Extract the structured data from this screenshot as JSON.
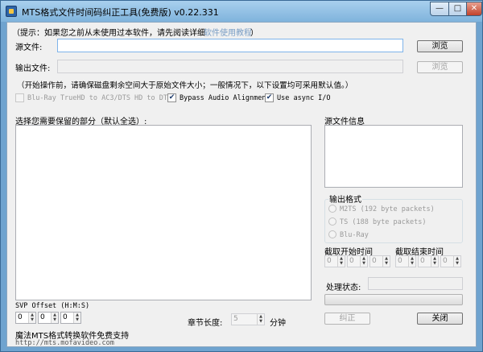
{
  "window": {
    "title": "MTS格式文件时间码纠正工具(免费版) v0.22.331",
    "minimize_label": "—",
    "maximize_label": "□",
    "close_label": "✕"
  },
  "hint": {
    "text": "（提示：如果您之前从未使用过本软件，请先阅读详细",
    "link": "软件使用教程",
    "suffix": "）"
  },
  "source": {
    "label": "源文件:",
    "value": "",
    "browse_label": "浏览"
  },
  "output": {
    "label": "输出文件:",
    "value": "",
    "browse_label": "浏览"
  },
  "notice": "（开始操作前，请确保磁盘剩余空间大于原始文件大小；一般情况下，以下设置均可采用默认值。）",
  "options": [
    {
      "label": "Blu-Ray TrueHD to AC3/DTS HD to DTS",
      "checked": false,
      "enabled": false
    },
    {
      "label": "Bypass Audio Alignment",
      "checked": true,
      "enabled": true
    },
    {
      "label": "Use async I/O",
      "checked": true,
      "enabled": true
    }
  ],
  "parts": {
    "label": "选择您需要保留的部分（默认全选）:"
  },
  "source_info": {
    "label": "源文件信息"
  },
  "output_format": {
    "label": "输出格式",
    "options": [
      {
        "label": "M2TS (192 byte packets)"
      },
      {
        "label": "TS (188 byte packets)"
      },
      {
        "label": "Blu-Ray"
      }
    ]
  },
  "start_time": {
    "label": "截取开始时间",
    "fields": [
      "0",
      "0",
      "0"
    ]
  },
  "end_time": {
    "label": "截取结束时间",
    "fields": [
      "0",
      "0",
      "0"
    ]
  },
  "status": {
    "label": "处理状态:",
    "value": "",
    "progress": 0
  },
  "svp": {
    "label": "SVP Offset (H:M:S)",
    "fields": [
      "0",
      "0",
      "0"
    ]
  },
  "chapter": {
    "label": "章节长度:",
    "value": "5",
    "unit": "分钟"
  },
  "buttons": {
    "fix_label": "纠正",
    "close_label": "关闭"
  },
  "footer": {
    "support_text": "魔法MTS格式转换软件免费支持",
    "url": "http://mts.mofavideo.com"
  },
  "colors": {
    "frame": "#6fa3cf",
    "client": "#f0f0f0",
    "link": "#7a9ec5"
  }
}
